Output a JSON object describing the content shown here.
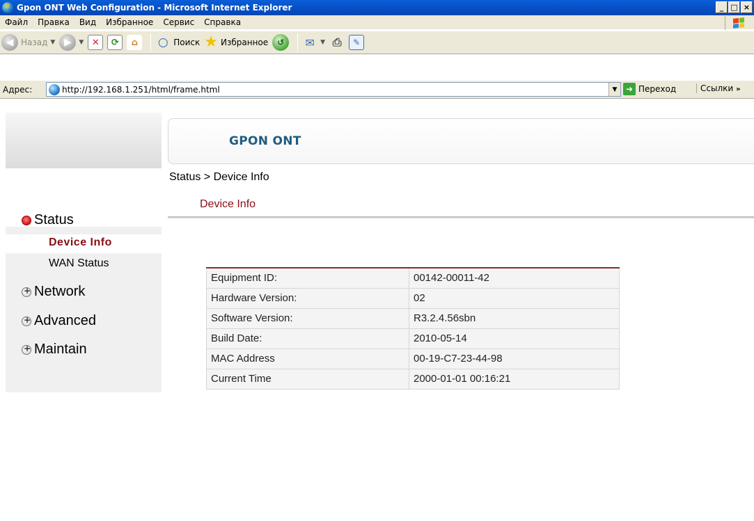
{
  "window": {
    "title": "Gpon ONT Web Configuration - Microsoft Internet Explorer"
  },
  "menu": [
    "Файл",
    "Правка",
    "Вид",
    "Избранное",
    "Сервис",
    "Справка"
  ],
  "toolbar": {
    "back": "Назад",
    "search": "Поиск",
    "favorites": "Избранное"
  },
  "address": {
    "label": "Адрес:",
    "url": "http://192.168.1.251/html/frame.html",
    "go": "Переход",
    "links": "Ссылки"
  },
  "page": {
    "brand": "GPON ONT",
    "breadcrumb": "Status > Device Info",
    "section_title": "Device Info"
  },
  "nav": {
    "status": "Status",
    "device_info": "Device Info",
    "wan_status": "WAN Status",
    "network": "Network",
    "advanced": "Advanced",
    "maintain": "Maintain"
  },
  "device_info": [
    {
      "label": "Equipment ID:",
      "value": "00142-00011-42"
    },
    {
      "label": "Hardware Version:",
      "value": "02"
    },
    {
      "label": "Software Version:",
      "value": "R3.2.4.56sbn"
    },
    {
      "label": "Build Date:",
      "value": "2010-05-14"
    },
    {
      "label": "MAC Address",
      "value": "00-19-C7-23-44-98"
    },
    {
      "label": "Current Time",
      "value": "2000-01-01 00:16:21"
    }
  ],
  "colors": {
    "accent": "#8b0d14",
    "brand": "#1f5d80",
    "titlebar": "#0753c9"
  }
}
